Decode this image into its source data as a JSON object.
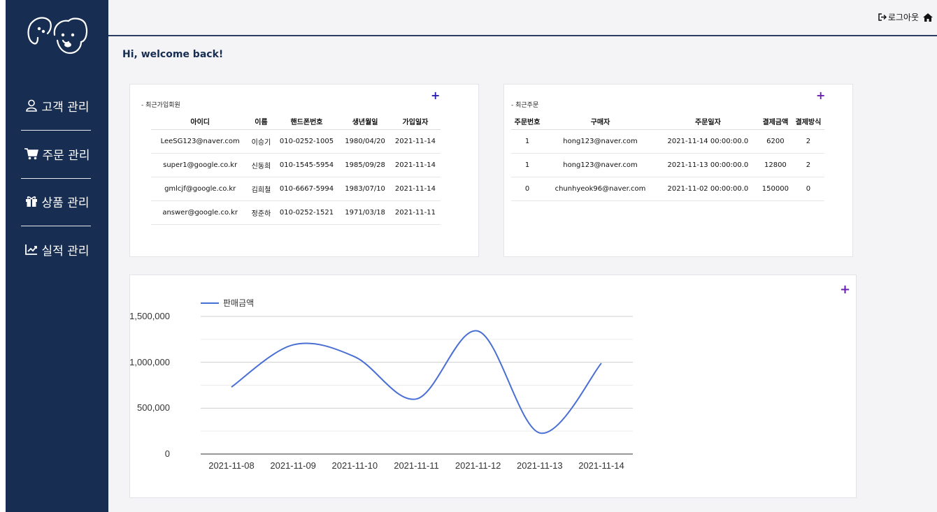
{
  "nav": {
    "customers": "고객 관리",
    "orders": "주문 관리",
    "products": "상품 관리",
    "performance": "실적 관리"
  },
  "topbar": {
    "logout_label": "로그아웃"
  },
  "welcome": "Hi, welcome back!",
  "recent_members": {
    "title": "- 최근가입회원",
    "plus": "+",
    "headers": [
      "아이디",
      "이름",
      "핸드폰번호",
      "생년월일",
      "가입일자"
    ],
    "rows": [
      [
        "LeeSG123@naver.com",
        "이승기",
        "010-0252-1005",
        "1980/04/20",
        "2021-11-14"
      ],
      [
        "super1@google.co.kr",
        "신동희",
        "010-1545-5954",
        "1985/09/28",
        "2021-11-14"
      ],
      [
        "gmlcjf@google.co.kr",
        "김희철",
        "010-6667-5994",
        "1983/07/10",
        "2021-11-14"
      ],
      [
        "answer@google.co.kr",
        "정준하",
        "010-0252-1521",
        "1971/03/18",
        "2021-11-11"
      ]
    ]
  },
  "recent_orders": {
    "title": "- 최근주문",
    "plus": "+",
    "headers": [
      "주문번호",
      "구매자",
      "주문일자",
      "결제금액",
      "결제방식"
    ],
    "rows": [
      [
        "1",
        "hong123@naver.com",
        "2021-11-14 00:00:00.0",
        "6200",
        "2"
      ],
      [
        "1",
        "hong123@naver.com",
        "2021-11-13 00:00:00.0",
        "12800",
        "2"
      ],
      [
        "0",
        "chunhyeok96@naver.com",
        "2021-11-02 00:00:00.0",
        "150000",
        "0"
      ]
    ]
  },
  "sales_chart_card": {
    "plus": "+"
  },
  "colors": {
    "sidebar": "#172d52",
    "line": "#4a6fd4",
    "plus": "#2a1fb0"
  },
  "chart_data": {
    "type": "line",
    "categories": [
      "2021-11-08",
      "2021-11-09",
      "2021-11-10",
      "2021-11-11",
      "2021-11-12",
      "2021-11-13",
      "2021-11-14"
    ],
    "series": [
      {
        "name": "판매금액",
        "values": [
          730000,
          1190000,
          1060000,
          600000,
          1340000,
          230000,
          990000
        ]
      }
    ],
    "ylim": [
      0,
      1500000
    ],
    "yticks": [
      "0",
      "500,000",
      "1,000,000",
      "1,500,000"
    ],
    "legend": "top-left",
    "grid": true
  }
}
